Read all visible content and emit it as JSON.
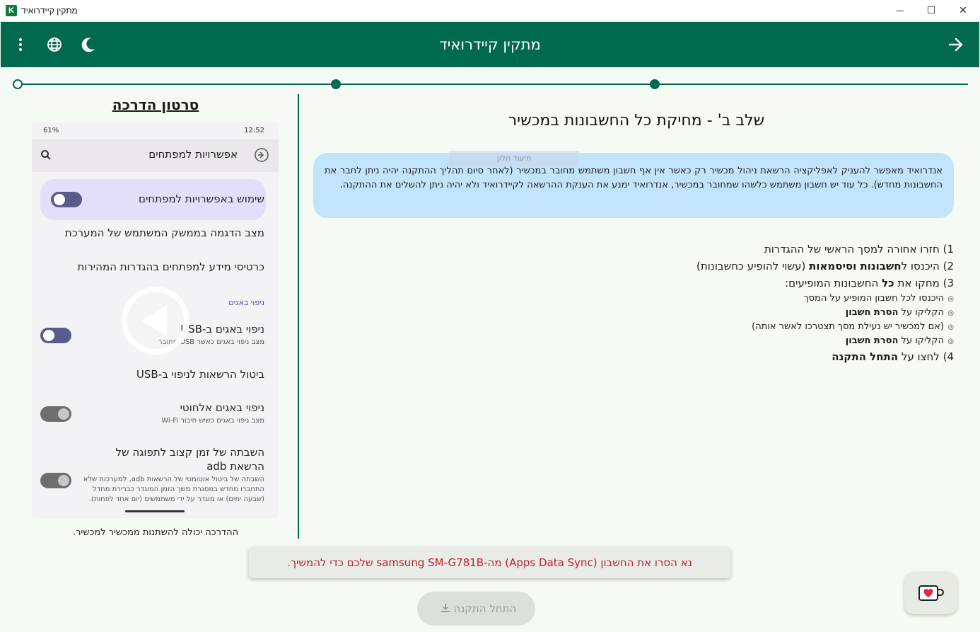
{
  "window": {
    "title": "מתקין קיידרואיד",
    "app_icon_letter": "K",
    "minimize": "—",
    "maximize": "☐",
    "close": "✕"
  },
  "header": {
    "title": "מתקין קיידרואיד",
    "icons": [
      "more-vert-icon",
      "globe-icon",
      "moon-icon",
      "arrow-right-icon"
    ]
  },
  "stepper": {
    "steps": 3,
    "current_step": 1
  },
  "video": {
    "title": "סרטון הדרכה",
    "caption": "ההדרכה יכולה להשתנות ממכשיר למכשיר.",
    "phone": {
      "battery": "61%",
      "time": "12:52",
      "topbar_title": "אפשרויות למפתחים",
      "row_use": "שימוש באפשרויות למפתחים",
      "row_demo": "מצב הדגמה בממשק המשתמש של המערכת",
      "row_tiles": "כרטיסי מידע למפתחים בהגדרות המהירות",
      "category": "ניפוי באגים",
      "row_usb": "ניפוי באגים ב-USB",
      "row_usb_sub": "מצב ניפוי באגים כאשר USB מחובר",
      "row_revoke": "ביטול הרשאות לניפוי ב-USB",
      "row_wireless": "ניפוי באגים אלחוטי",
      "row_wireless_sub": "מצב ניפוי באגים כשיש חיבור Wi-Fi",
      "row_timeout_1": "השבתה של זמן קצוב לתפוגה של",
      "row_timeout_2": "הרשאת adb",
      "row_timeout_sub": "השבתה של ביטול אוטומטי של הרשאות adb, למערכות שלא התחברו מחדש במסגרת משך הזמן המוגדר כברירת מחדל (שבעה ימים) או מוגדר על ידי משתמשים (יום אחד לפחות)."
    }
  },
  "step": {
    "title": "שלב ב' - מחיקת כל החשבונות במכשיר",
    "tooltip_ghost": "תיעוד חלון",
    "info": "אנדרואיד מאפשר להעניק לאפליקציה הרשאת ניהול מכשיר רק כאשר אין אף חשבון משתמש מחובר במכשיר (לאחר סיום תהליך ההתקנה יהיה ניתן לחבר את החשבונות מחדש). כל עוד יש חשבון משתמש כלשהו שמחובר במכשיר, אנדרואיד ימנע את הענקת ההרשאה לקיידרואיד ולא יהיה ניתן להשלים את ההתקנה.",
    "instructions": {
      "s1": "1) חזרו אחורה למסך הראשי של ההגדרות",
      "s2_pre": "2) היכנסו ל",
      "s2_bold": "חשבונות וסיסמאות",
      "s2_post": " (עשוי להופיע כחשבונות)",
      "s3_pre": "3) מחקו את ",
      "s3_bold": "כל",
      "s3_post": " החשבונות המופיעים:",
      "bullet": "◎",
      "b1": "היכנסו לכל חשבון המופיע על המסך",
      "b2_pre": "הקליקו על ",
      "b2_bold": "הסרת חשבון",
      "b3": "(אם למכשיר יש נעילת מסך תצטרכו לאשר אותה)",
      "b4_pre": "הקליקו על ",
      "b4_bold": "הסרת חשבון",
      "s4_pre": "4) לחצו על ",
      "s4_bold": "התחל התקנה"
    }
  },
  "snackbar": {
    "message": "נא הסרו את החשבון (Apps Data Sync) מה-samsung SM-G781B שלכם כדי להמשיך.",
    "color": "#c0202c"
  },
  "install_button": {
    "label": "התחל התקנה",
    "enabled": false
  },
  "donate_button": {
    "icon": "heart-mug-icon"
  },
  "colors": {
    "primary": "#006a4e",
    "info_bg": "#c2e4fa",
    "background": "#f6faf4"
  }
}
